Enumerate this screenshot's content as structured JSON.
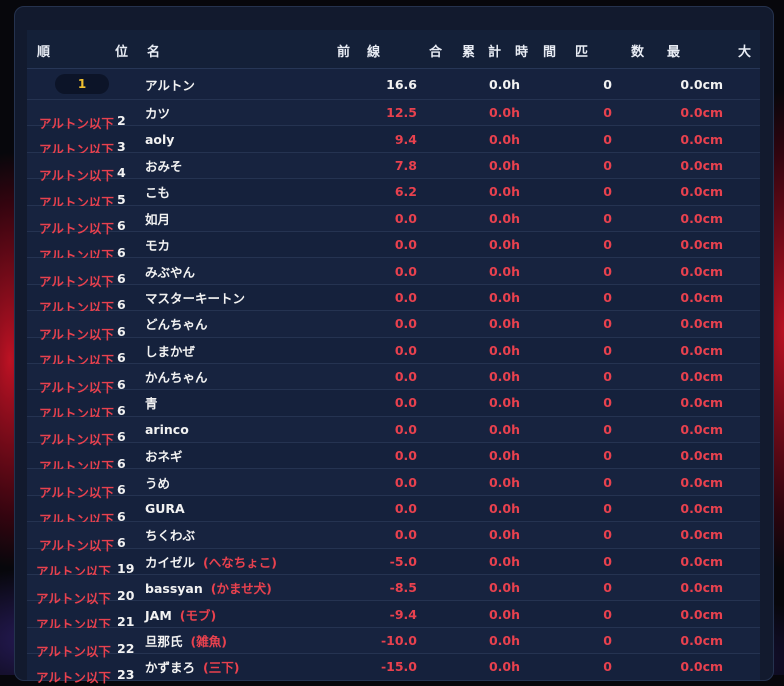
{
  "header": {
    "col1a": "順",
    "col1b": "位",
    "col2": "名",
    "col3a": "前",
    "col3b": "線",
    "col4a": "合",
    "col4b": "累",
    "col4c": "計",
    "col4d": "時",
    "col4e": "間",
    "col5a": "匹",
    "col5b": "数",
    "col6a": "最",
    "col6b": "大"
  },
  "first_row": {
    "rank": "1",
    "name": "アルトン",
    "score": "16.6",
    "time": "0.0h",
    "count": "0",
    "max": "0.0cm"
  },
  "rows": [
    {
      "label": "アルトン以下",
      "rank": "2",
      "name": "カツ",
      "suffix": "",
      "score": "12.5",
      "time": "0.0h",
      "count": "0",
      "max": "0.0cm"
    },
    {
      "label": "アルトン以下",
      "rank": "3",
      "name": "aoly",
      "suffix": "",
      "score": "9.4",
      "time": "0.0h",
      "count": "0",
      "max": "0.0cm"
    },
    {
      "label": "アルトン以下",
      "rank": "4",
      "name": "おみそ",
      "suffix": "",
      "score": "7.8",
      "time": "0.0h",
      "count": "0",
      "max": "0.0cm"
    },
    {
      "label": "アルトン以下",
      "rank": "5",
      "name": "こも",
      "suffix": "",
      "score": "6.2",
      "time": "0.0h",
      "count": "0",
      "max": "0.0cm"
    },
    {
      "label": "アルトン以下",
      "rank": "6",
      "name": "如月",
      "suffix": "",
      "score": "0.0",
      "time": "0.0h",
      "count": "0",
      "max": "0.0cm"
    },
    {
      "label": "アルトン以下",
      "rank": "6",
      "name": "モカ",
      "suffix": "",
      "score": "0.0",
      "time": "0.0h",
      "count": "0",
      "max": "0.0cm"
    },
    {
      "label": "アルトン以下",
      "rank": "6",
      "name": "みぶやん",
      "suffix": "",
      "score": "0.0",
      "time": "0.0h",
      "count": "0",
      "max": "0.0cm"
    },
    {
      "label": "アルトン以下",
      "rank": "6",
      "name": "マスターキートン",
      "suffix": "",
      "score": "0.0",
      "time": "0.0h",
      "count": "0",
      "max": "0.0cm"
    },
    {
      "label": "アルトン以下",
      "rank": "6",
      "name": "どんちゃん",
      "suffix": "",
      "score": "0.0",
      "time": "0.0h",
      "count": "0",
      "max": "0.0cm"
    },
    {
      "label": "アルトン以下",
      "rank": "6",
      "name": "しまかぜ",
      "suffix": "",
      "score": "0.0",
      "time": "0.0h",
      "count": "0",
      "max": "0.0cm"
    },
    {
      "label": "アルトン以下",
      "rank": "6",
      "name": "かんちゃん",
      "suffix": "",
      "score": "0.0",
      "time": "0.0h",
      "count": "0",
      "max": "0.0cm"
    },
    {
      "label": "アルトン以下",
      "rank": "6",
      "name": "青",
      "suffix": "",
      "score": "0.0",
      "time": "0.0h",
      "count": "0",
      "max": "0.0cm"
    },
    {
      "label": "アルトン以下",
      "rank": "6",
      "name": "arinco",
      "suffix": "",
      "score": "0.0",
      "time": "0.0h",
      "count": "0",
      "max": "0.0cm"
    },
    {
      "label": "アルトン以下",
      "rank": "6",
      "name": "おネギ",
      "suffix": "",
      "score": "0.0",
      "time": "0.0h",
      "count": "0",
      "max": "0.0cm"
    },
    {
      "label": "アルトン以下",
      "rank": "6",
      "name": "うめ",
      "suffix": "",
      "score": "0.0",
      "time": "0.0h",
      "count": "0",
      "max": "0.0cm"
    },
    {
      "label": "アルトン以下",
      "rank": "6",
      "name": "GURA",
      "suffix": "",
      "score": "0.0",
      "time": "0.0h",
      "count": "0",
      "max": "0.0cm"
    },
    {
      "label": "アルトン以下",
      "rank": "6",
      "name": "ちくわぶ",
      "suffix": "",
      "score": "0.0",
      "time": "0.0h",
      "count": "0",
      "max": "0.0cm"
    },
    {
      "label": "アルトン以下",
      "rank": "19",
      "name": "カイゼル",
      "suffix": "(へなちょこ)",
      "score": "-5.0",
      "time": "0.0h",
      "count": "0",
      "max": "0.0cm"
    },
    {
      "label": "アルトン以下",
      "rank": "20",
      "name": "bassyan",
      "suffix": "(かませ犬)",
      "score": "-8.5",
      "time": "0.0h",
      "count": "0",
      "max": "0.0cm"
    },
    {
      "label": "アルトン以下",
      "rank": "21",
      "name": "JAM",
      "suffix": "(モブ)",
      "score": "-9.4",
      "time": "0.0h",
      "count": "0",
      "max": "0.0cm"
    },
    {
      "label": "アルトン以下",
      "rank": "22",
      "name": "旦那氏",
      "suffix": "(雑魚)",
      "score": "-10.0",
      "time": "0.0h",
      "count": "0",
      "max": "0.0cm"
    },
    {
      "label": "アルトン以下",
      "rank": "23",
      "name": "かずまろ",
      "suffix": "(三下)",
      "score": "-15.0",
      "time": "0.0h",
      "count": "0",
      "max": "0.0cm"
    }
  ]
}
